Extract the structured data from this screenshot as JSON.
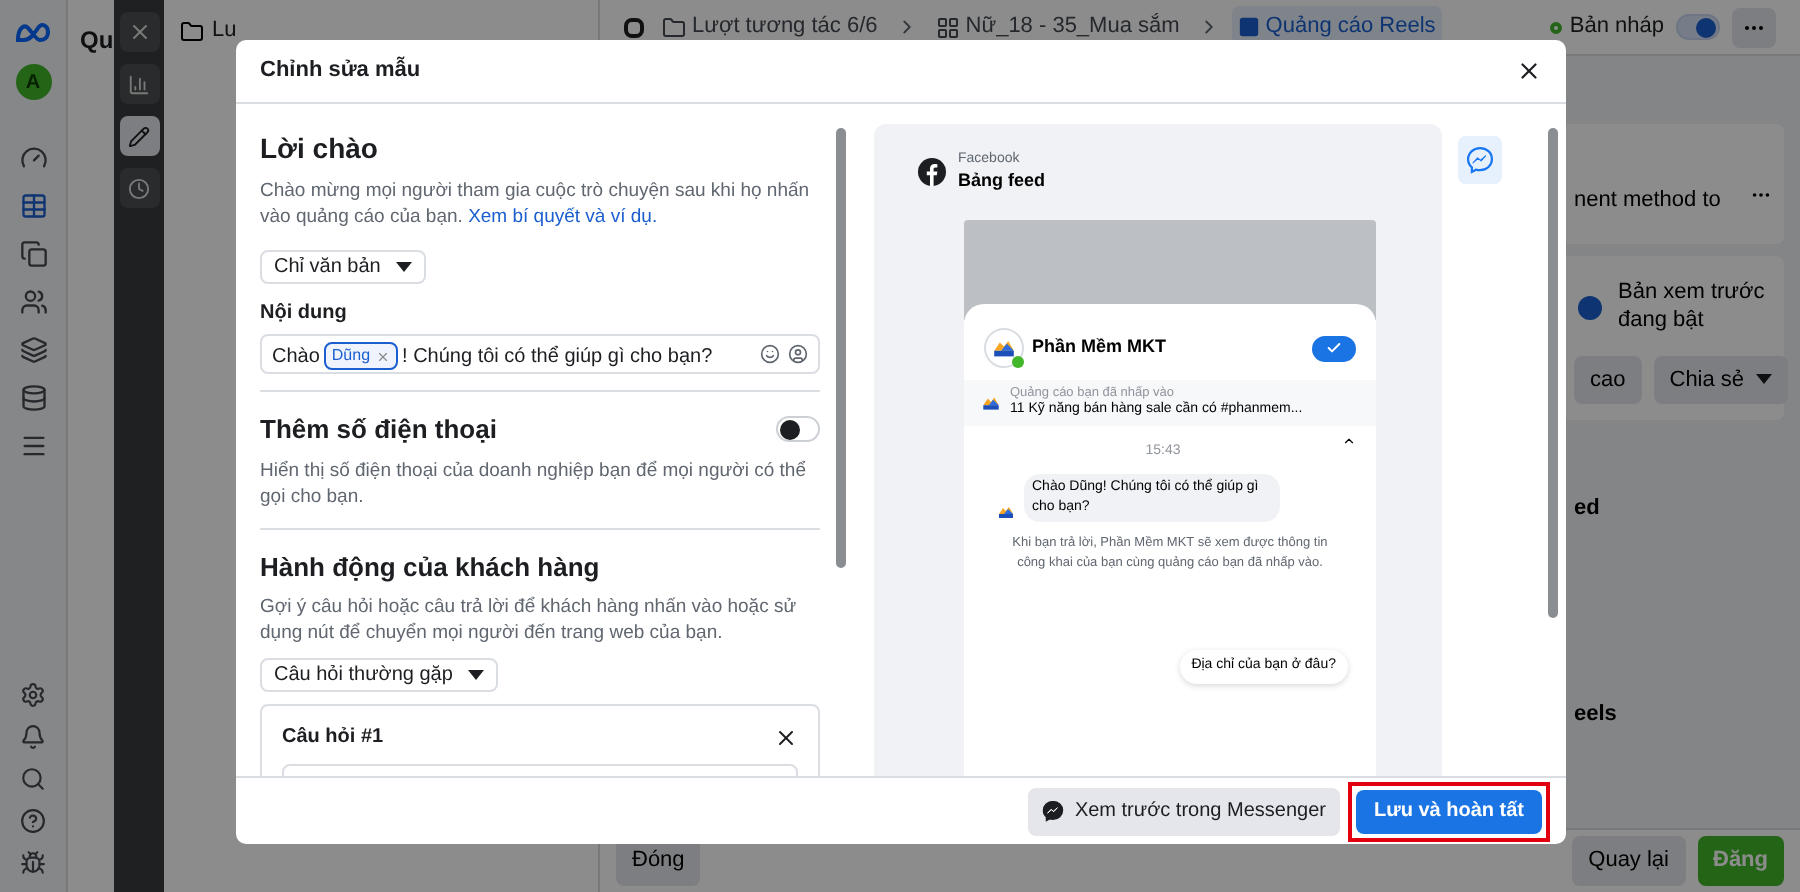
{
  "nav_rail": {
    "avatar": "A"
  },
  "side_panel": {
    "title": "Qu"
  },
  "tree": {
    "folder": "Lu"
  },
  "breadcrumb": [
    {
      "label": "Lượt tương tác 6/6",
      "kind": "campaign",
      "selected": false
    },
    {
      "label": "Nữ_18 - 35_Mua sắm",
      "kind": "adset",
      "selected": false
    },
    {
      "label": "Quảng cáo Reels",
      "kind": "ad",
      "selected": true
    }
  ],
  "status": {
    "label": "Bản nháp",
    "on": true
  },
  "right_panel": {
    "notice": "nent method to",
    "preview_label": "Bản xem trước đang bật",
    "buttons": [
      "cao",
      "Chia sẻ"
    ],
    "section_1": "ed",
    "section_2": "eels"
  },
  "bottom_bar": {
    "close": "Đóng",
    "back": "Quay lại",
    "publish": "Đăng"
  },
  "modal": {
    "title": "Chỉnh sửa mẫu",
    "greeting": {
      "heading": "Lời chào",
      "description": "Chào mừng mọi người tham gia cuộc trò chuyện sau khi họ nhấn vào quảng cáo của bạn.",
      "link": "Xem bí quyết và ví dụ.",
      "dropdown": "Chỉ văn bản",
      "content_label": "Nội dung",
      "message_start": "Chào",
      "token": "Dũng",
      "message_end": "! Chúng tôi có thể giúp gì cho bạn?"
    },
    "phone": {
      "heading": "Thêm số điện thoại",
      "description": "Hiển thị số điện thoại của doanh nghiệp bạn để mọi người có thể gọi cho bạn.",
      "on": false
    },
    "actions": {
      "heading": "Hành động của khách hàng",
      "description": "Gợi ý câu hỏi hoặc câu trả lời để khách hàng nhấn vào hoặc sử dụng nút để chuyển mọi người đến trang web của bạn.",
      "dropdown": "Câu hỏi thường gặp",
      "question_title": "Câu hỏi #1"
    },
    "preview": {
      "platform": "Facebook",
      "placement": "Bảng feed",
      "page_name": "Phần Mềm MKT",
      "ad_label": "Quảng cáo bạn đã nhấp vào",
      "ad_title": "11 Kỹ năng bán hàng sale cần có #phanmem...",
      "time": "15:43",
      "bubble": "Chào Dũng! Chúng tôi có thể giúp gì cho bạn?",
      "note": "Khi bạn trả lời, Phần Mềm MKT sẽ xem được thông tin công khai của bạn cùng quảng cáo bạn đã nhấp vào.",
      "quick_replies": [
        "Địa chỉ của bạn ở đâu?"
      ]
    },
    "footer": {
      "preview_button": "Xem trước trong Messenger",
      "save_button": "Lưu và hoàn tất",
      "save_highlighted": true
    }
  }
}
